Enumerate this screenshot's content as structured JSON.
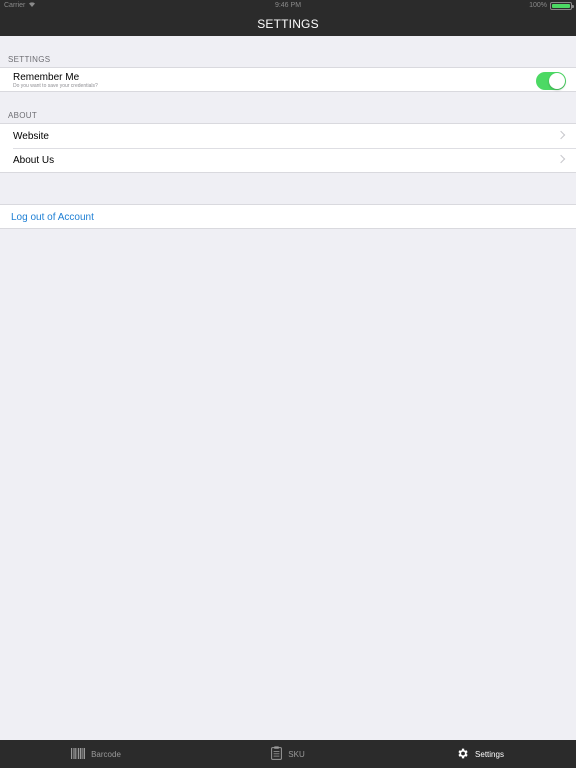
{
  "status_bar": {
    "carrier": "Carrier",
    "time": "9:46 PM",
    "battery_text": "100%",
    "battery_level": 1.0
  },
  "nav": {
    "title": "SETTINGS"
  },
  "settings_section": {
    "header": "SETTINGS",
    "remember_me": {
      "label": "Remember Me",
      "subtitle": "Do you want to save your credentials?",
      "enabled": true
    }
  },
  "about_section": {
    "header": "ABOUT",
    "items": [
      {
        "label": "Website"
      },
      {
        "label": "About Us"
      }
    ]
  },
  "logout": {
    "label": "Log out of Account",
    "color": "#1e7fd4"
  },
  "tabs": [
    {
      "label": "Barcode",
      "icon": "barcode-icon",
      "active": false
    },
    {
      "label": "SKU",
      "icon": "clipboard-icon",
      "active": false
    },
    {
      "label": "Settings",
      "icon": "gear-icon",
      "active": true
    }
  ],
  "colors": {
    "bars": "#2b2b2b",
    "background": "#efeff4",
    "toggle_on": "#4cd964",
    "link": "#1e7fd4"
  }
}
